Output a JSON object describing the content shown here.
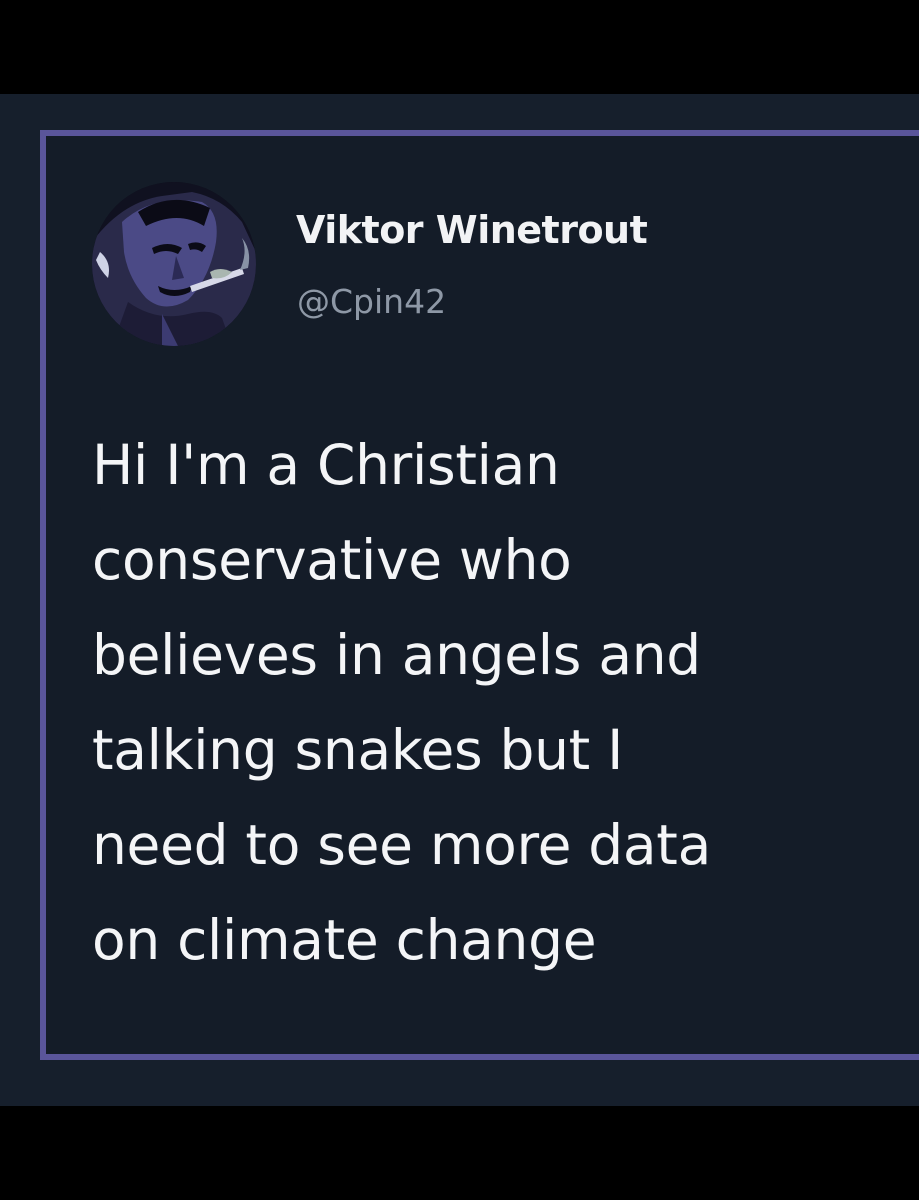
{
  "tweet": {
    "author": {
      "display_name": "Viktor Winetrout",
      "handle": "@Cpin42",
      "avatar_icon": "comic-portrait-smoking-avatar"
    },
    "text_lines": [
      "Hi I'm a Christian",
      "conservative who",
      "believes in angels and",
      "talking snakes but I",
      "need to see more data",
      "on climate change"
    ]
  },
  "colors": {
    "page_background": "#000000",
    "panel_background": "#161f2c",
    "card_border": "#5a559a",
    "name_text": "#f2f3f5",
    "handle_text": "#8e98a6",
    "body_text": "#f4f5f7"
  }
}
